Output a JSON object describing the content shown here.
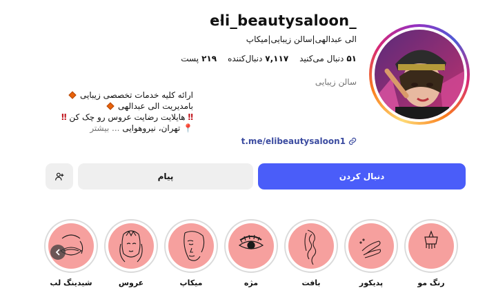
{
  "profile": {
    "username": "eli_beautysaloon_",
    "more_icon": "⋯",
    "full_name": "الی عبدالهی|سالن زیبایی|میکاپ",
    "stats": {
      "posts_count": "۲۱۹",
      "posts_label": "پست",
      "followers_count": "۷,۱۱۷",
      "followers_label": "دنبال‌کننده",
      "following_count": "۵۱",
      "following_label": "دنبال می‌کنید"
    },
    "category": "سالن زیبایی",
    "bio": {
      "line1": "ارائه کلیه خدمات تخصصی زیبایی",
      "line2": "بامدیریت الی عبدالهی",
      "line3": "هایلایت رضایت عروس رو چک کن",
      "line4": "تهران، نیروهوایی",
      "more": "... بیشتر"
    },
    "link": "t.me/elibeautysaloon1"
  },
  "actions": {
    "follow_label": "دنبال کردن",
    "message_label": "پیام",
    "add_user_icon": "person-plus-icon"
  },
  "highlights": [
    {
      "label": "رنگ مو",
      "icon": "hair-dye-brush-icon"
    },
    {
      "label": "پدیکور",
      "icon": "feet-icon"
    },
    {
      "label": "بافت",
      "icon": "braid-icon"
    },
    {
      "label": "مژه",
      "icon": "eyelash-icon"
    },
    {
      "label": "میکاپ",
      "icon": "makeup-face-icon"
    },
    {
      "label": "عروس",
      "icon": "bride-icon"
    },
    {
      "label": "شیدینگ لب",
      "icon": "lips-icon"
    }
  ],
  "colors": {
    "accent_blue": "#4a5df9",
    "highlight_pink": "#f6a09e",
    "link_color": "#3b4ba0",
    "muted_text": "#737373"
  }
}
